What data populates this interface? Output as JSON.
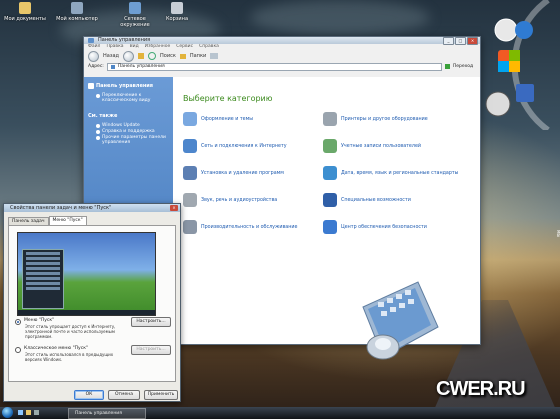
{
  "desktop": {
    "icons": [
      {
        "label": "Мои документы"
      },
      {
        "label": "Мой компьютер"
      },
      {
        "label": "Сетевое окружение"
      },
      {
        "label": "Корзина"
      }
    ],
    "watermark": "CWER.RU"
  },
  "window": {
    "title": "Панель управления",
    "menu": [
      "Файл",
      "Правка",
      "Вид",
      "Избранное",
      "Сервис",
      "Справка"
    ],
    "toolbar": {
      "back": "Назад",
      "search": "Поиск",
      "folders": "Папки"
    },
    "address": {
      "label": "Адрес:",
      "value": "Панель управления",
      "go": "Переход"
    },
    "sidebar": {
      "panel_title": "Панель управления",
      "switch_view": "Переключение к классическому виду",
      "see_also": "См. также",
      "links": [
        "Windows Update",
        "Справка и поддержка",
        "Прочие параметры панели управления"
      ]
    },
    "main": {
      "heading": "Выберите категорию",
      "categories": [
        "Оформление и темы",
        "Принтеры и другое оборудование",
        "Сеть и подключения к Интернету",
        "Учетные записи пользователей",
        "Установка и удаление программ",
        "Дата, время, язык и региональные стандарты",
        "Звук, речь и аудиоустройства",
        "Специальные возможности",
        "Производительность и обслуживание",
        "Центр обеспечения безопасности"
      ]
    }
  },
  "dialog": {
    "title": "Свойства панели задач и меню \"Пуск\"",
    "tabs": [
      "Панель задач",
      "Меню \"Пуск\""
    ],
    "options": [
      {
        "label": "Меню \"Пуск\"",
        "description": "Этот стиль упрощает доступ к Интернету, электронной почте и часто используемым программам.",
        "selected": true,
        "button": "Настроить..."
      },
      {
        "label": "Классическое меню \"Пуск\"",
        "description": "Этот стиль использовался в предыдущих версиях Windows.",
        "selected": false,
        "button": "Настроить..."
      }
    ],
    "buttons": {
      "ok": "ОК",
      "cancel": "Отмена",
      "apply": "Применить"
    }
  },
  "taskbar": {
    "task": "Панель управления"
  },
  "colors": {
    "accent": "#3c8a1e",
    "link": "#1e5bb0",
    "sidebar": "#4a80c2"
  }
}
